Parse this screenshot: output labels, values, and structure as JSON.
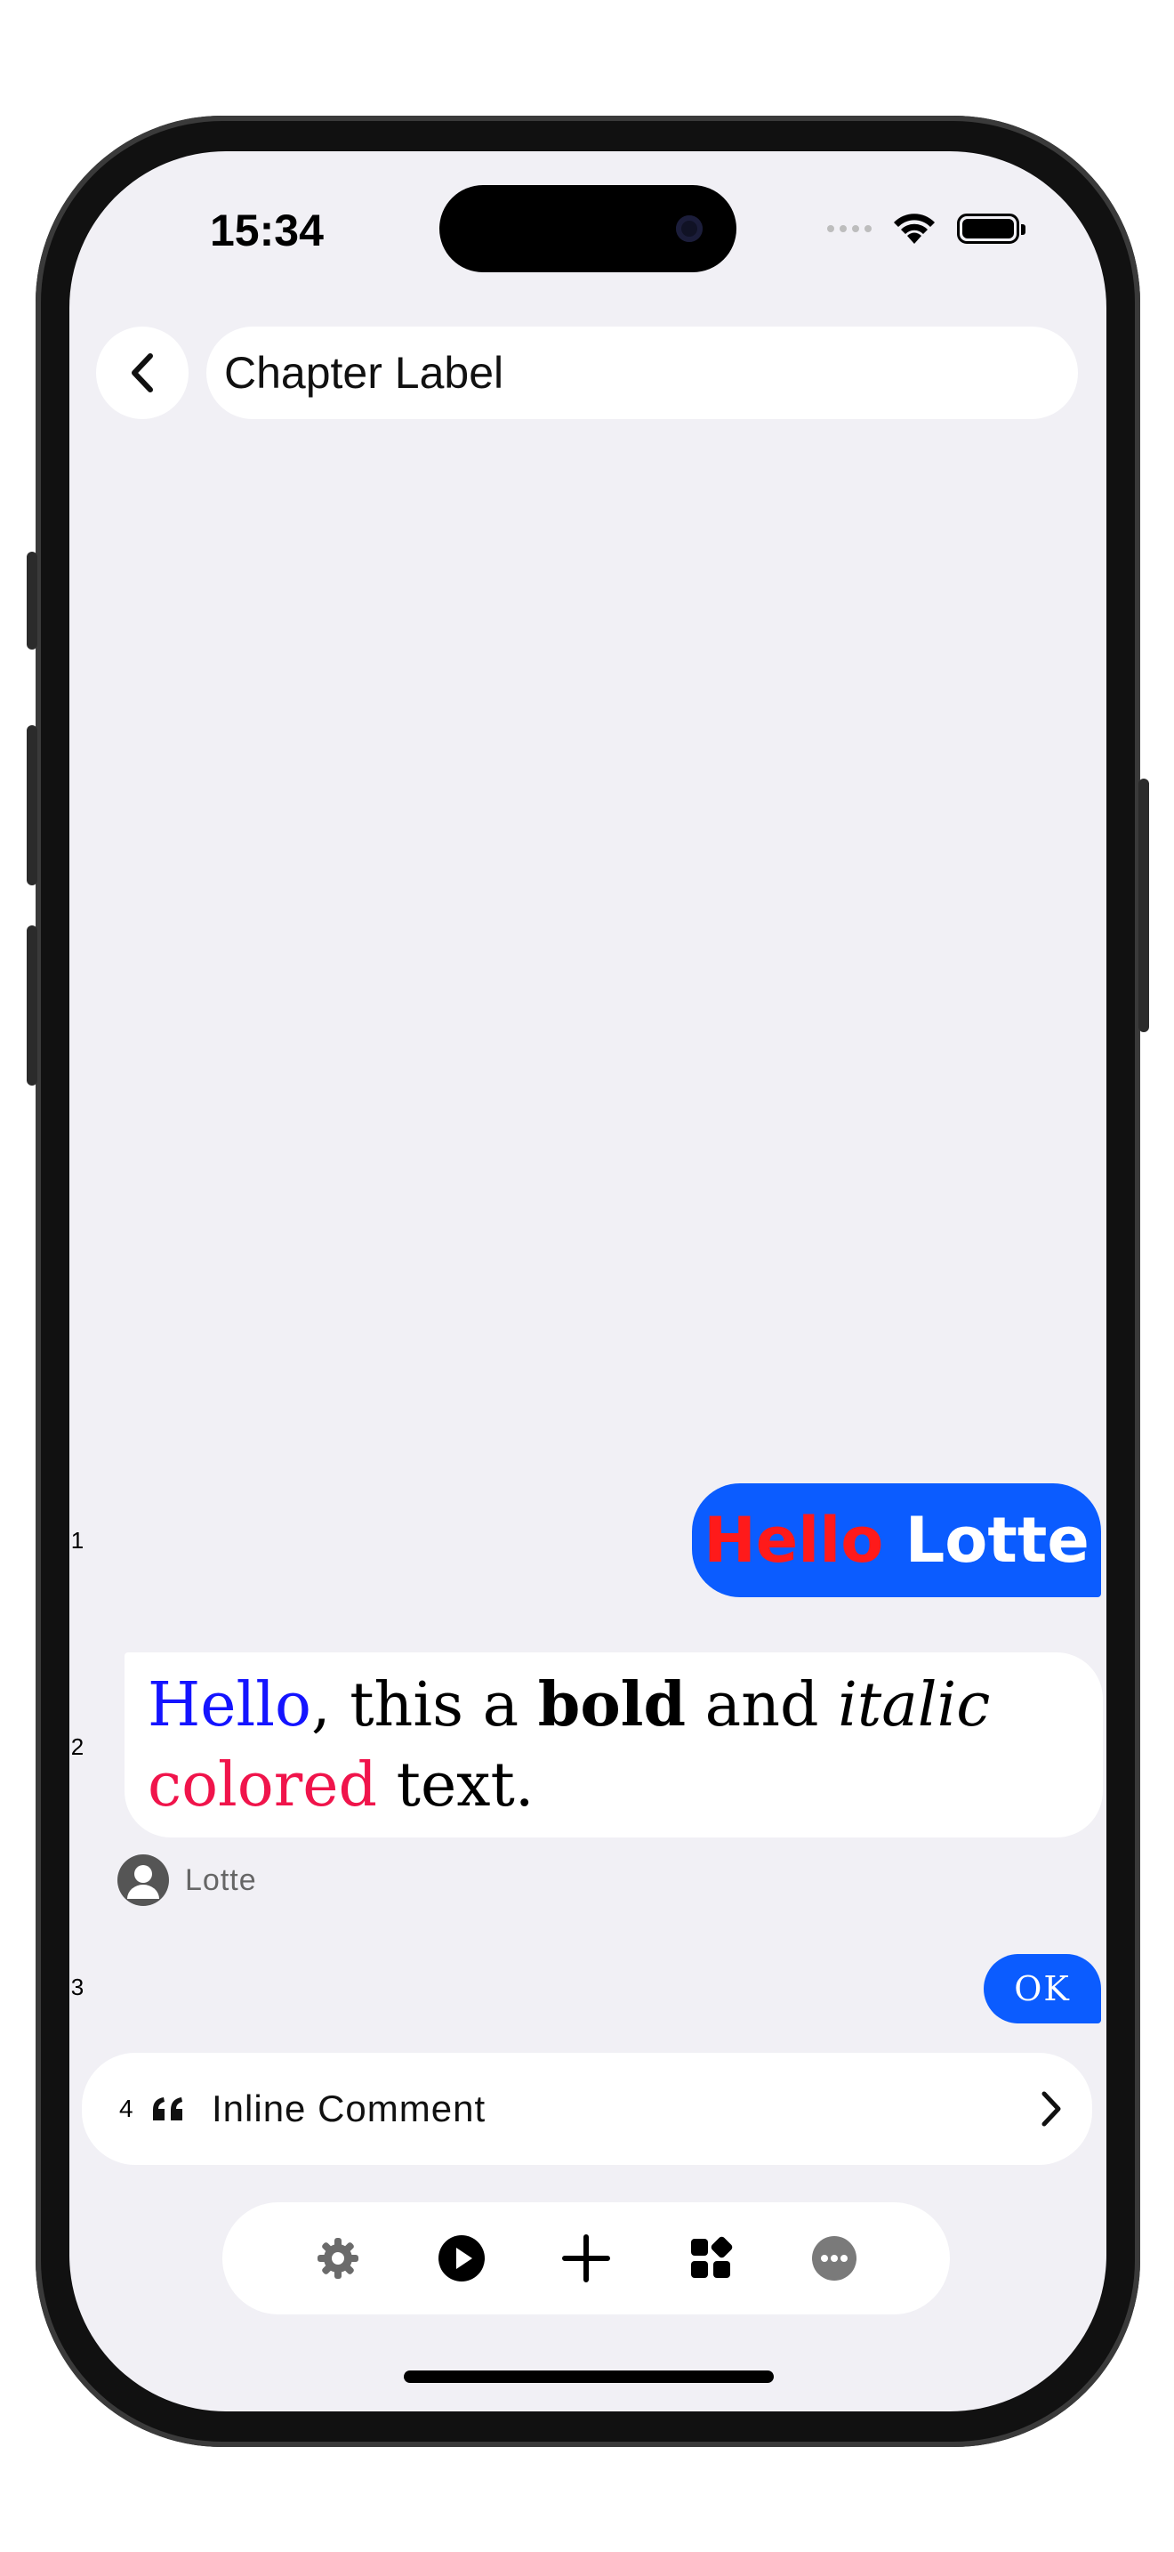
{
  "status_bar": {
    "time": "15:34"
  },
  "nav": {
    "title": "Chapter Label",
    "back_icon": "chevron-left-icon"
  },
  "messages": [
    {
      "index": "1",
      "parts": [
        {
          "text": "Hello",
          "color": "#ff1a1a"
        },
        {
          "text": " Lotte",
          "color": "#ffffff"
        }
      ]
    },
    {
      "index": "2",
      "parts": [
        {
          "text": "Hello",
          "color": "#1414ff",
          "style": "normal"
        },
        {
          "text": ", this a ",
          "style": "normal"
        },
        {
          "text": "bold",
          "style": "bold"
        },
        {
          "text": " and ",
          "style": "normal"
        },
        {
          "text": "italic",
          "style": "italic"
        },
        {
          "text": " ",
          "style": "normal"
        },
        {
          "text": "colored",
          "color": "#f0144b",
          "style": "normal"
        },
        {
          "text": " text.",
          "style": "normal"
        }
      ],
      "author": "Lotte"
    },
    {
      "index": "3",
      "text": "OK"
    }
  ],
  "comment": {
    "index": "4",
    "label": "Inline Comment",
    "icon": "quote-icon"
  },
  "toolbar": {
    "icons": [
      "gear-icon",
      "play-icon",
      "plus-icon",
      "widgets-icon",
      "more-icon"
    ]
  },
  "colors": {
    "accent": "#0b5cff",
    "background": "#f1f0f5"
  }
}
